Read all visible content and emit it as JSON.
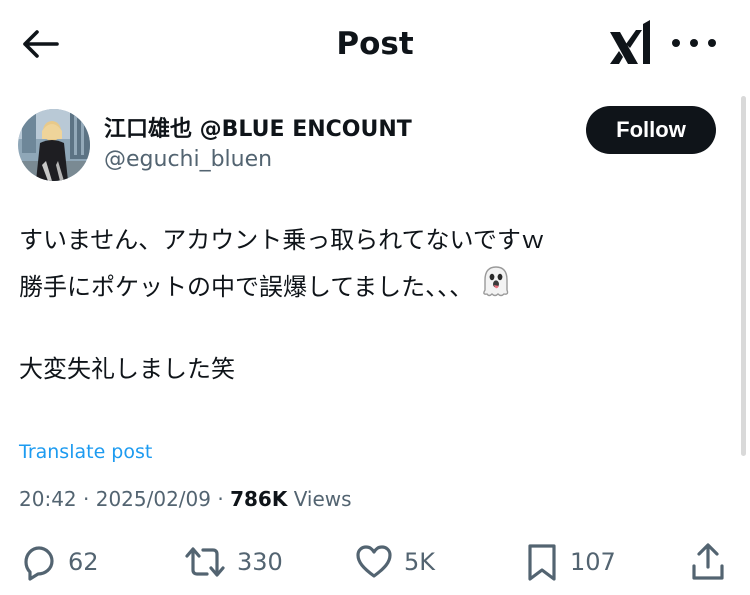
{
  "header": {
    "title": "Post",
    "back_icon": "arrow-left-icon",
    "grok_icon": "grok-icon",
    "more_icon": "more-horizontal-icon"
  },
  "author": {
    "name": "江口雄也 @BLUE ENCOUNT",
    "handle": "@eguchi_bluen",
    "follow_label": "Follow"
  },
  "post": {
    "lines": [
      "すいません、アカウント乗っ取られてないですｗ",
      "勝手にポケットの中で誤爆してました、、、",
      "大変失礼しました笑"
    ],
    "emoji": "ghost-emoji",
    "translate_label": "Translate post",
    "time": "20:42",
    "date": "2025/02/09",
    "separator": "·",
    "views_count": "786K",
    "views_label": "Views"
  },
  "actions": {
    "replies": "62",
    "reposts": "330",
    "likes": "5K",
    "bookmarks": "107"
  },
  "colors": {
    "text": "#0f1419",
    "secondary": "#536471",
    "link": "#1d9bf0",
    "button_bg": "#0f1419"
  }
}
